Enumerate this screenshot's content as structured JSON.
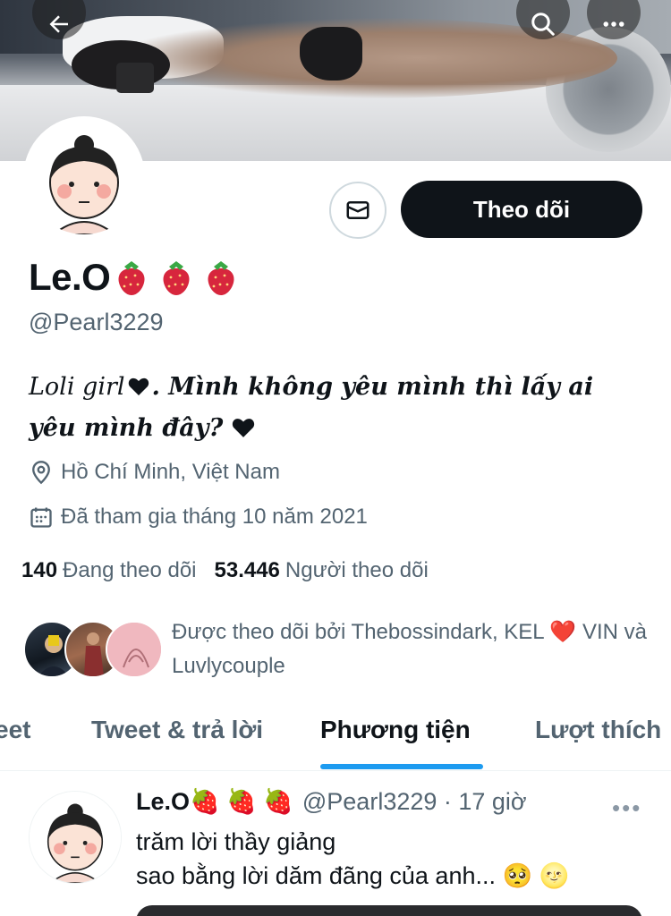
{
  "header": {
    "back_icon": "arrow-left-icon",
    "search_icon": "search-icon",
    "more_icon": "more-horizontal-icon"
  },
  "profile": {
    "name": "Le.O",
    "name_emojis": [
      "🍓",
      "🍓",
      "🍓"
    ],
    "handle": "@Pearl3229",
    "bio_part1": "Loli girl",
    "bio_part2": ". Mình không yêu mình thì lấy ai yêu mình đây? ",
    "location": "Hồ Chí Minh, Việt Nam",
    "joined": "Đã tham gia tháng 10 năm 2021",
    "following_count": "140",
    "following_label": "Đang theo dõi",
    "followers_count": "53.446",
    "followers_label": "Người theo dõi",
    "followed_by_text": "Được theo dõi bởi Thebossindark, KEL ❤️ VIN và Luvlycouple"
  },
  "actions": {
    "message_icon": "mail-icon",
    "follow_label": "Theo dõi"
  },
  "tabs": [
    {
      "label": "eet"
    },
    {
      "label": "Tweet & trả lời"
    },
    {
      "label": "Phương tiện"
    },
    {
      "label": "Lượt thích"
    }
  ],
  "active_tab": 2,
  "tweet": {
    "name": "Le.O🍓 🍓 🍓",
    "meta": "@Pearl3229 · 17 giờ",
    "line1": "trăm lời thầy giảng",
    "line2": "sao bằng lời dăm đãng của anh... 🥺 🌝"
  },
  "colors": {
    "accent": "#1d9bf0",
    "text": "#0f1419",
    "secondary": "#536471",
    "follow_button": "#0f1419"
  }
}
